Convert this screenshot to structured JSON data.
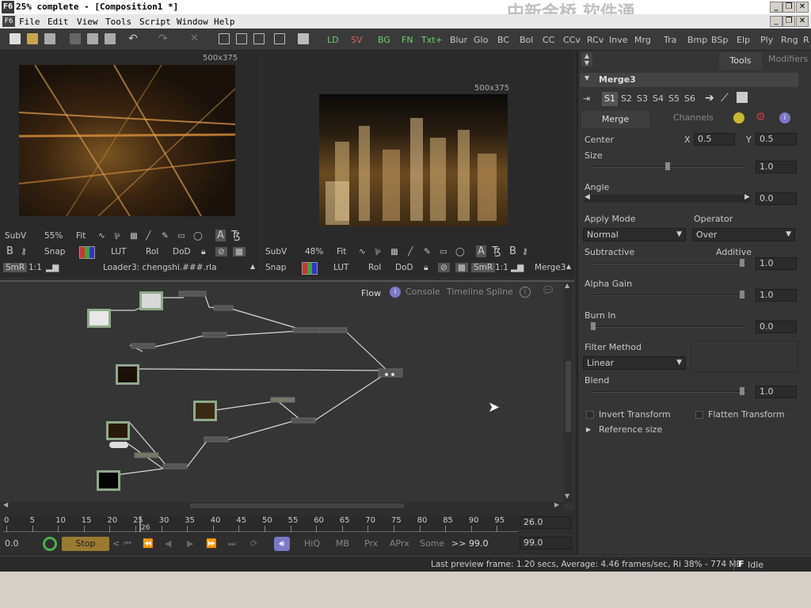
{
  "window": {
    "title": "25% complete - [Composition1 *]",
    "app_icon": "F6"
  },
  "menu": [
    "File",
    "Edit",
    "View",
    "Tools",
    "Script",
    "Window",
    "Help"
  ],
  "watermark": "中新金桥 软件通",
  "toolbar": {
    "tools": [
      "LD",
      "SV",
      "BG",
      "FN",
      "Txt+",
      "Blur",
      "Glo",
      "BC",
      "Bol",
      "CC",
      "CCv",
      "RCv",
      "Inve",
      "Mrg",
      "Tra",
      "Bmp",
      "BSp",
      "Elp",
      "Ply",
      "Rng",
      "R"
    ]
  },
  "viewer_left": {
    "resolution": "500x375",
    "subv": "SubV",
    "zoom": "55%",
    "fit": "Fit",
    "b": "B",
    "snap": "Snap",
    "lut": "LUT",
    "roi": "RoI",
    "dod": "DoD",
    "smr": "SmR",
    "ratio": "1:1",
    "source": "Loader3: chengshi.###.rla"
  },
  "viewer_right": {
    "resolution": "500x375",
    "subv": "SubV",
    "zoom": "48%",
    "fit": "Fit",
    "b": "B",
    "snap": "Snap",
    "lut": "LUT",
    "roi": "RoI",
    "dod": "DoD",
    "smr": "SmR",
    "ratio": "1:1",
    "source": "Merge3"
  },
  "flow_tabs": [
    "Flow",
    "Console",
    "Timeline",
    "Spline"
  ],
  "timeline": {
    "ticks": [
      "0",
      "5",
      "10",
      "15",
      "20",
      "25",
      "30",
      "35",
      "40",
      "45",
      "50",
      "55",
      "60",
      "65",
      "70",
      "75",
      "80",
      "85",
      "90",
      "95"
    ],
    "current_marker": "26",
    "end_value": "26.0",
    "start": "0.0",
    "stop_label": "Stop",
    "buttons": [
      "HiQ",
      "MB",
      "Prx",
      "APrx",
      "Some"
    ],
    "chev": ">>",
    "end_time": "99.0",
    "global_end": "99.0"
  },
  "status": {
    "text": "Last preview frame: 1.20 secs, Average: 4.46 frames/sec, Ri 38% - 774 MB",
    "state_icon": "F",
    "state": "Idle"
  },
  "props": {
    "tabs": [
      "Tools",
      "Modifiers"
    ],
    "tool_name": "Merge3",
    "slots": [
      "S1",
      "S2",
      "S3",
      "S4",
      "S5",
      "S6"
    ],
    "subtabs": [
      "Merge",
      "Channels"
    ],
    "center_label": "Center",
    "center_x_label": "X",
    "center_x": "0.5",
    "center_y_label": "Y",
    "center_y": "0.5",
    "size_label": "Size",
    "size_value": "1.0",
    "angle_label": "Angle",
    "angle_value": "0.0",
    "apply_mode_label": "Apply Mode",
    "apply_mode": "Normal",
    "operator_label": "Operator",
    "operator": "Over",
    "subtractive": "Subtractive",
    "additive": "Additive",
    "sub_add_value": "1.0",
    "alpha_gain_label": "Alpha Gain",
    "alpha_gain": "1.0",
    "burn_in_label": "Burn In",
    "burn_in": "0.0",
    "filter_method_label": "Filter Method",
    "filter_method": "Linear",
    "blend_label": "Blend",
    "blend": "1.0",
    "invert_transform": "Invert Transform",
    "flatten_transform": "Flatten Transform",
    "reference_size": "Reference size"
  },
  "colors": {
    "accent_blue": "#7b78c8",
    "node_thumb_border": "#8faa8a",
    "stop_button": "#9a7a30"
  }
}
